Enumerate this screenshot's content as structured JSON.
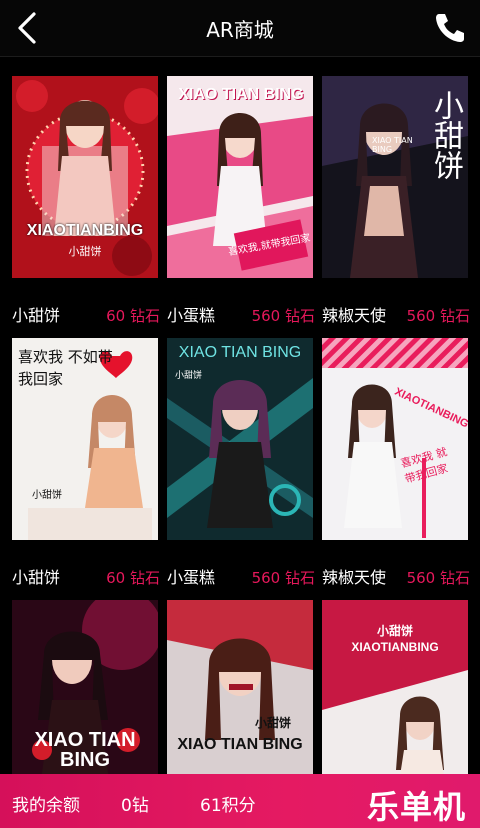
{
  "header": {
    "title": "AR商城",
    "back_icon": "chevron-left-icon",
    "phone_icon": "phone-icon"
  },
  "products": [
    {
      "name": "小甜饼",
      "price": "60 钻石",
      "poster": {
        "title": "XIAOTIANBING",
        "sub": "小甜饼",
        "colors": [
          "#c2121e",
          "#f3d3c9"
        ]
      }
    },
    {
      "name": "小蛋糕",
      "price": "560 钻石",
      "poster": {
        "title": "XIAO TIAN BING",
        "sub": "喜欢我,就带我回家",
        "colors": [
          "#e94c84",
          "#f7f0f2"
        ]
      }
    },
    {
      "name": "辣椒天使",
      "price": "560 钻石",
      "poster": {
        "title": "小甜饼",
        "sub": "XIAO TIAN BING",
        "colors": [
          "#1a1a26",
          "#3b2f4e"
        ]
      }
    },
    {
      "name": "小甜饼",
      "price": "60 钻石",
      "poster": {
        "title": "喜欢我 不如带我回家",
        "sub": "小甜饼",
        "colors": [
          "#f3f1ee",
          "#eac4b6"
        ]
      }
    },
    {
      "name": "小蛋糕",
      "price": "560 钻石",
      "poster": {
        "title": "XIAO TIAN BING",
        "sub": "小甜饼",
        "colors": [
          "#0d2b2f",
          "#1b5b6a"
        ]
      }
    },
    {
      "name": "辣椒天使",
      "price": "560 钻石",
      "poster": {
        "title": "XIAOTIANBING",
        "sub": "喜欢我 就带我回家",
        "colors": [
          "#f2f3f5",
          "#e91d5c"
        ]
      }
    },
    {
      "name": "",
      "price": "",
      "poster": {
        "title": "XIAO TIAN BING",
        "sub": "",
        "colors": [
          "#2a0716",
          "#b8184f"
        ]
      }
    },
    {
      "name": "",
      "price": "",
      "poster": {
        "title": "XIAO TIAN BING",
        "sub": "小甜饼",
        "colors": [
          "#e7dfe0",
          "#c52b3d"
        ]
      }
    },
    {
      "name": "",
      "price": "",
      "poster": {
        "title": "XIAOTIANBING",
        "sub": "小甜饼",
        "colors": [
          "#c71843",
          "#f0ecec"
        ]
      }
    }
  ],
  "footer": {
    "balance_label": "我的余额",
    "diamonds": "0钻",
    "points": "61积分",
    "brand": "乐单机"
  },
  "colors": {
    "accent": "#e6185b",
    "header_bg": "#060606",
    "page_bg": "#000000"
  }
}
